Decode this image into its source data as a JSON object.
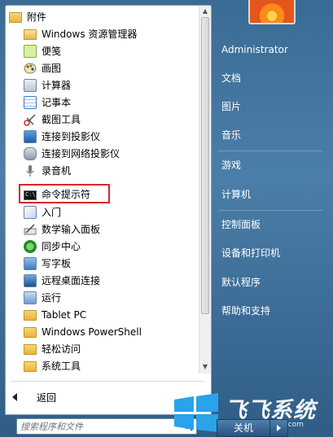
{
  "programs": {
    "folder_header": "附件",
    "items": [
      {
        "label": "Windows 资源管理器",
        "icon": "explorer-icon"
      },
      {
        "label": "便笺",
        "icon": "sticky-notes-icon"
      },
      {
        "label": "画图",
        "icon": "paint-icon"
      },
      {
        "label": "计算器",
        "icon": "calculator-icon"
      },
      {
        "label": "记事本",
        "icon": "notepad-icon"
      },
      {
        "label": "截图工具",
        "icon": "snipping-tool-icon"
      },
      {
        "label": "连接到投影仪",
        "icon": "projector-icon"
      },
      {
        "label": "连接到网络投影仪",
        "icon": "network-projector-icon"
      },
      {
        "label": "录音机",
        "icon": "sound-recorder-icon"
      },
      {
        "label": "命令提示符",
        "icon": "command-prompt-icon"
      },
      {
        "label": "入门",
        "icon": "getting-started-icon"
      },
      {
        "label": "数学输入面板",
        "icon": "math-input-icon"
      },
      {
        "label": "同步中心",
        "icon": "sync-center-icon"
      },
      {
        "label": "写字板",
        "icon": "wordpad-icon"
      },
      {
        "label": "远程桌面连接",
        "icon": "remote-desktop-icon"
      },
      {
        "label": "运行",
        "icon": "run-icon"
      },
      {
        "label": "Tablet PC",
        "icon": "folder-icon"
      },
      {
        "label": "Windows PowerShell",
        "icon": "folder-icon"
      },
      {
        "label": "轻松访问",
        "icon": "folder-icon"
      },
      {
        "label": "系统工具",
        "icon": "folder-icon"
      }
    ],
    "highlighted_item": "命令提示符"
  },
  "back_label": "返回",
  "search": {
    "placeholder": "搜索程序和文件"
  },
  "right_panel": {
    "user": "Administrator",
    "items": [
      "文档",
      "图片",
      "音乐",
      "游戏",
      "计算机",
      "控制面板",
      "设备和打印机",
      "默认程序",
      "帮助和支持"
    ]
  },
  "shutdown_label": "关机",
  "watermark": {
    "text": "飞飞系统",
    "url": "www.feifeixitong.com"
  },
  "colors": {
    "start_menu_bg": "#3a6b94",
    "highlight_border": "#d9262b",
    "folder": "#e8b33a"
  }
}
